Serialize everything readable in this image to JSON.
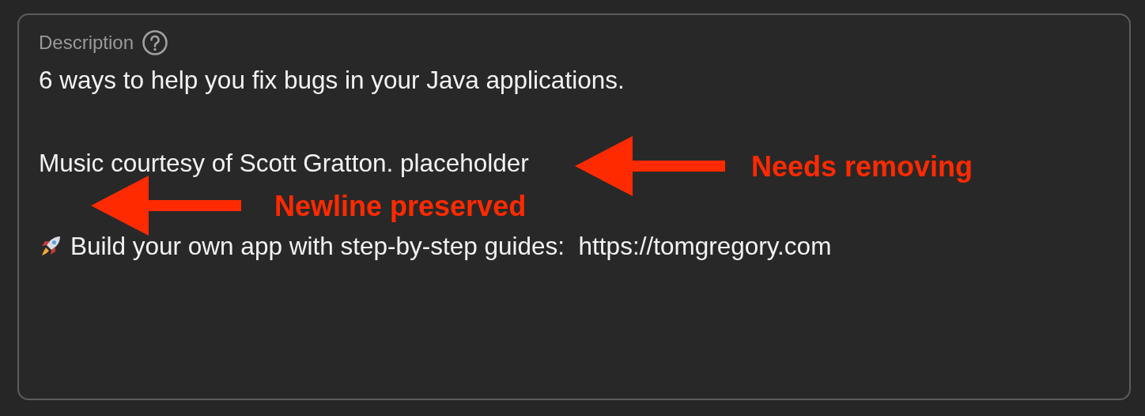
{
  "field": {
    "label": "Description",
    "paragraphs": [
      {
        "text": "6 ways to help you fix bugs in your Java applications.",
        "kind": "text"
      },
      {
        "text": "Music courtesy of Scott Gratton. placeholder",
        "kind": "text"
      },
      {
        "text": "Build your own app with step-by-step guides:  https://tomgregory.com",
        "kind": "rocket"
      }
    ]
  },
  "annotations": [
    {
      "text": "Needs removing"
    },
    {
      "text": "Newline preserved"
    }
  ]
}
